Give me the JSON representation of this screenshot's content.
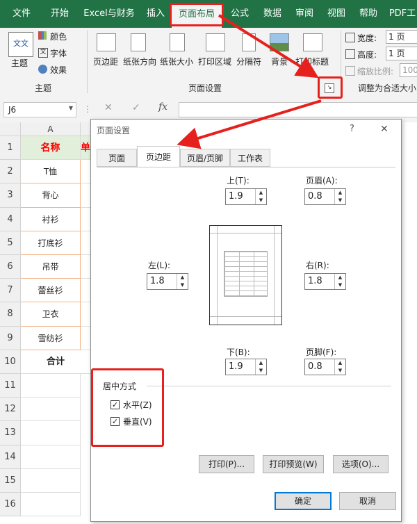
{
  "ribbon": {
    "tabs": [
      "文件",
      "开始",
      "Excel与财务",
      "插入",
      "页面布局",
      "公式",
      "数据",
      "审阅",
      "视图",
      "帮助",
      "PDF工"
    ],
    "active_tab": "页面布局",
    "theme_group": {
      "theme": "主题",
      "colors": "颜色",
      "fonts": "字体",
      "effects": "效果",
      "label": "主题",
      "icon_text": "文文"
    },
    "page_setup_group": {
      "margins": "页边距",
      "orientation": "纸张方向",
      "size": "纸张大小",
      "print_area": "打印区域",
      "breaks": "分隔符",
      "background": "背景",
      "print_titles": "打印标题",
      "label": "页面设置"
    },
    "scale_group": {
      "width_label": "宽度:",
      "width_value": "1 页",
      "height_label": "高度:",
      "height_value": "1 页",
      "scale_label": "缩放比例:",
      "scale_value": "100",
      "label": "调整为合适大小"
    }
  },
  "formula_bar": {
    "name_box": "J6",
    "fx": "fx"
  },
  "sheet": {
    "col_headers": [
      "A"
    ],
    "row_numbers": [
      "1",
      "2",
      "3",
      "4",
      "5",
      "6",
      "7",
      "8",
      "9",
      "10",
      "11",
      "12",
      "13",
      "14",
      "15",
      "16"
    ],
    "col_a": [
      "名称",
      "T恤",
      "背心",
      "衬衫",
      "打底衫",
      "吊带",
      "蕾丝衫",
      "卫衣",
      "雪纺衫",
      "合计"
    ],
    "col_b_partial": "单",
    "header_color": "#ff0000",
    "header_fill": "#e2efda"
  },
  "dialog": {
    "title": "页面设置",
    "help": "?",
    "close": "✕",
    "tabs": [
      "页面",
      "页边距",
      "页眉/页脚",
      "工作表"
    ],
    "active_tab": "页边距",
    "top": {
      "label": "上(T):",
      "value": "1.9"
    },
    "header": {
      "label": "页眉(A):",
      "value": "0.8"
    },
    "left": {
      "label": "左(L):",
      "value": "1.8"
    },
    "right": {
      "label": "右(R):",
      "value": "1.8"
    },
    "bottom": {
      "label": "下(B):",
      "value": "1.9"
    },
    "footer": {
      "label": "页脚(F):",
      "value": "0.8"
    },
    "center": {
      "label": "居中方式",
      "horizontal": "水平(Z)",
      "vertical": "垂直(V)",
      "horizontal_checked": true,
      "vertical_checked": true
    },
    "buttons": {
      "print": "打印(P)...",
      "preview": "打印预览(W)",
      "options": "选项(O)...",
      "ok": "确定",
      "cancel": "取消"
    }
  },
  "colors": {
    "excel_green": "#217346",
    "annotation_red": "#e6211d"
  }
}
